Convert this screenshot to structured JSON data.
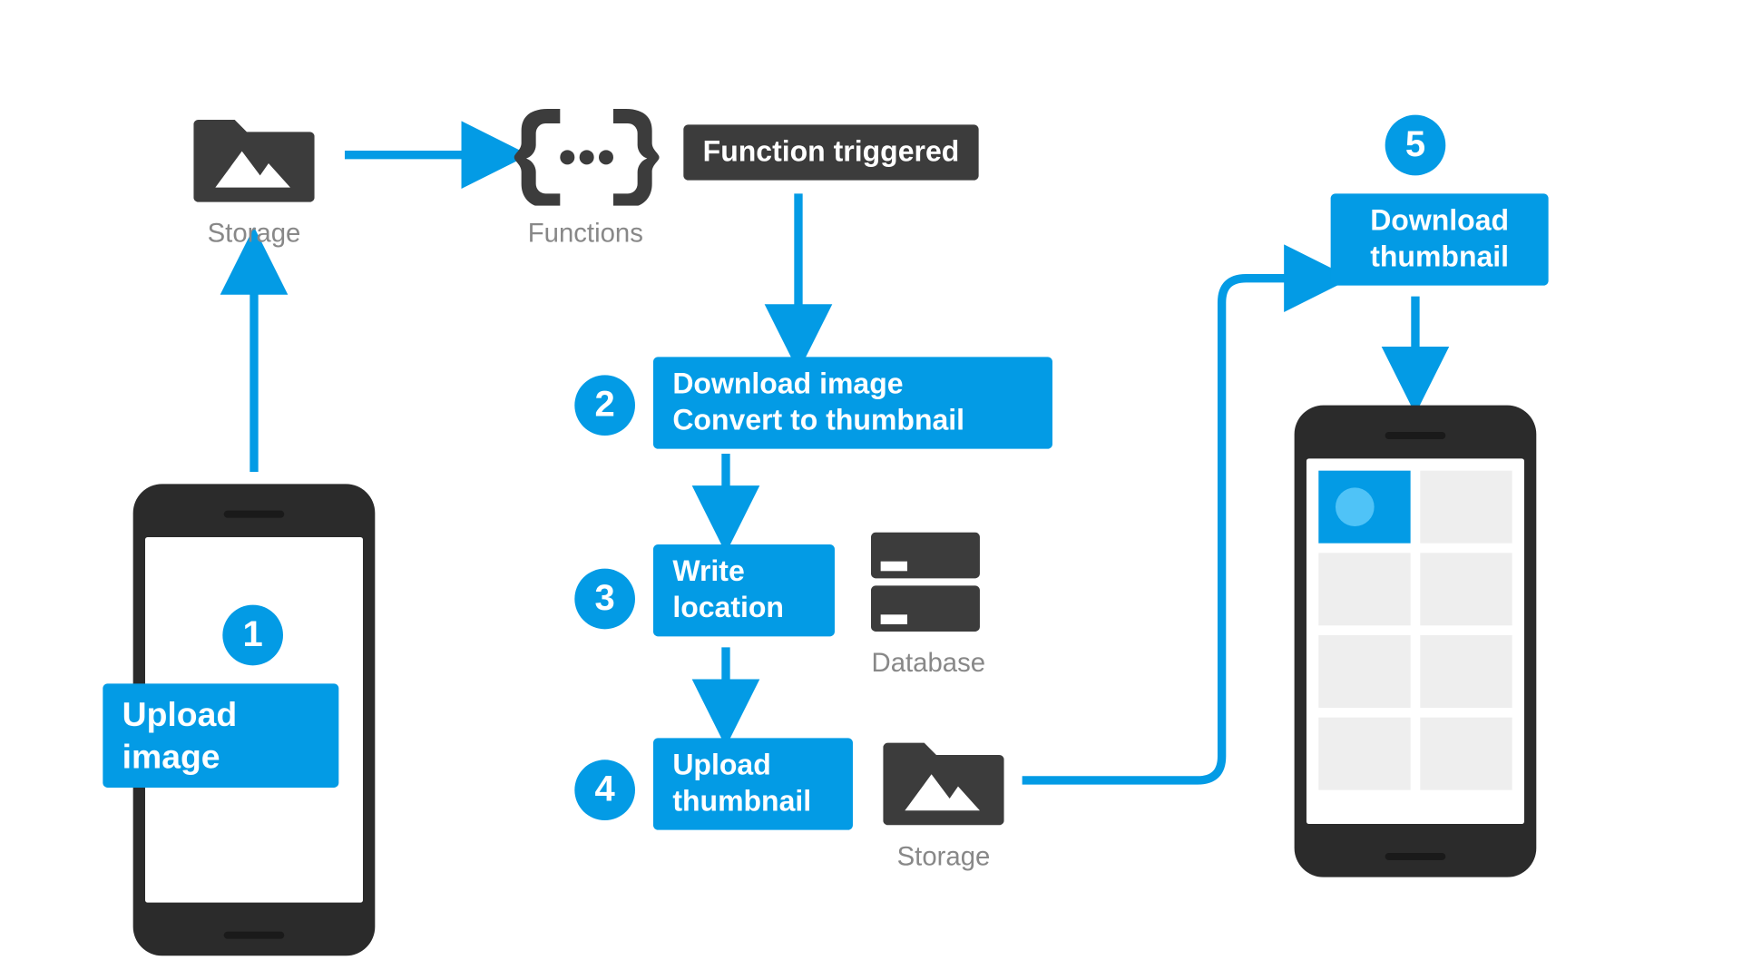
{
  "icons": {
    "storage_top": "Storage",
    "functions": "Functions",
    "database": "Database",
    "storage_bottom": "Storage"
  },
  "steps": {
    "one": {
      "num": "1",
      "label": "Upload image"
    },
    "triggered": "Function triggered",
    "two": {
      "num": "2",
      "label_line1": "Download image",
      "label_line2": "Convert to thumbnail"
    },
    "three": {
      "num": "3",
      "label_line1": "Write",
      "label_line2": "location"
    },
    "four": {
      "num": "4",
      "label_line1": "Upload",
      "label_line2": "thumbnail"
    },
    "five": {
      "num": "5",
      "label_line1": "Download",
      "label_line2": "thumbnail"
    }
  },
  "colors": {
    "accent": "#039be5",
    "dark": "#3c3c3c",
    "muted": "#888"
  }
}
